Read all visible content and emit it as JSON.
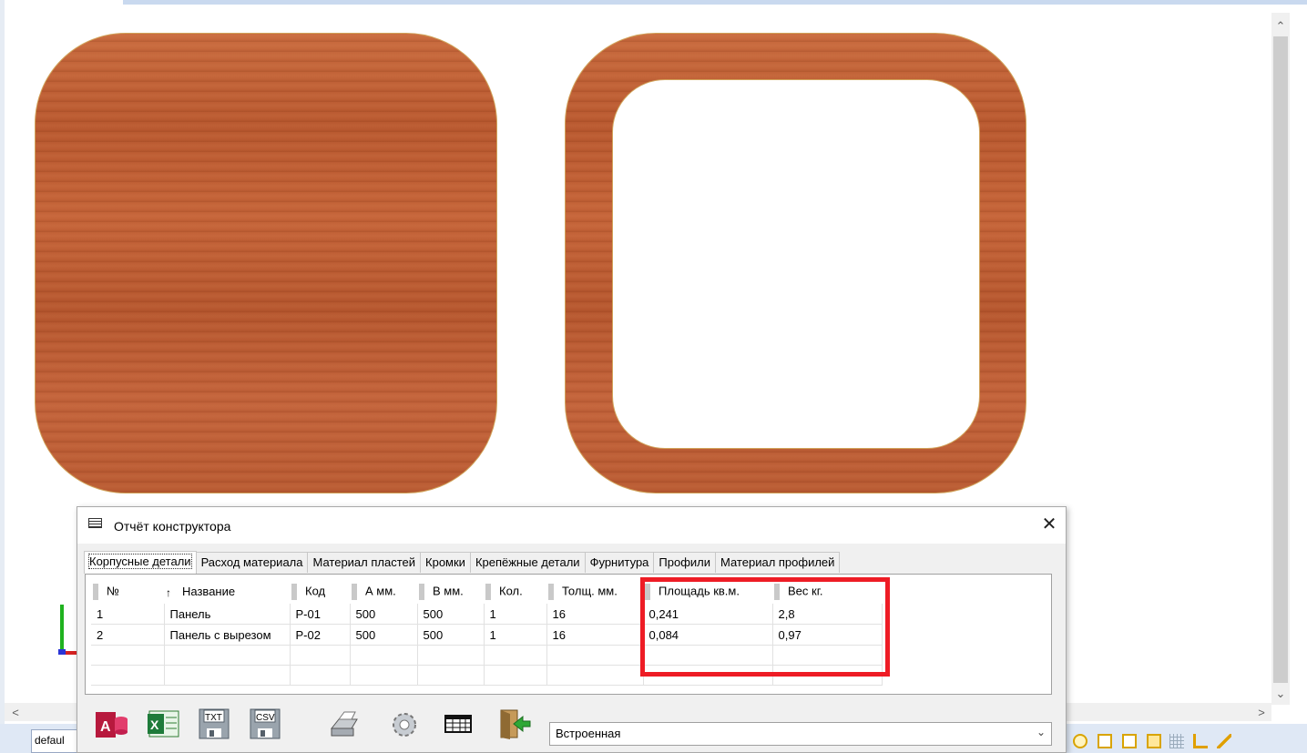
{
  "viewport": {
    "panel_texture_color": "#bf5f35",
    "edge_color": "#d1a35a",
    "layer_tab_label": "defaul"
  },
  "dialog": {
    "title": "Отчёт конструктора",
    "close_glyph": "✕",
    "tabs": [
      "Корпусные детали",
      "Расход материала",
      "Материал пластей",
      "Кромки",
      "Крепёжные детали",
      "Фурнитура",
      "Профили",
      "Материал профилей"
    ],
    "active_tab": "Корпусные детали",
    "table": {
      "headers": [
        "№",
        "Название",
        "Код",
        "А мм.",
        "В мм.",
        "Кол.",
        "Толщ. мм.",
        "Площадь кв.м.",
        "Вес кг."
      ],
      "sort_column": "Название",
      "rows": [
        [
          "1",
          "Панель",
          "P-01",
          "500",
          "500",
          "1",
          "16",
          "0,241",
          "2,8"
        ],
        [
          "2",
          "Панель с вырезом",
          "P-02",
          "500",
          "500",
          "1",
          "16",
          "0,084",
          "0,97"
        ]
      ]
    },
    "toolbar": {
      "buttons": [
        "access-export",
        "excel-export",
        "txt-export",
        "csv-export",
        "print",
        "settings",
        "table-view",
        "exit"
      ],
      "txt_label": "TXT",
      "csv_label": "CSV",
      "report_select_value": "Встроенная"
    },
    "highlight_color": "#ee1c25"
  }
}
